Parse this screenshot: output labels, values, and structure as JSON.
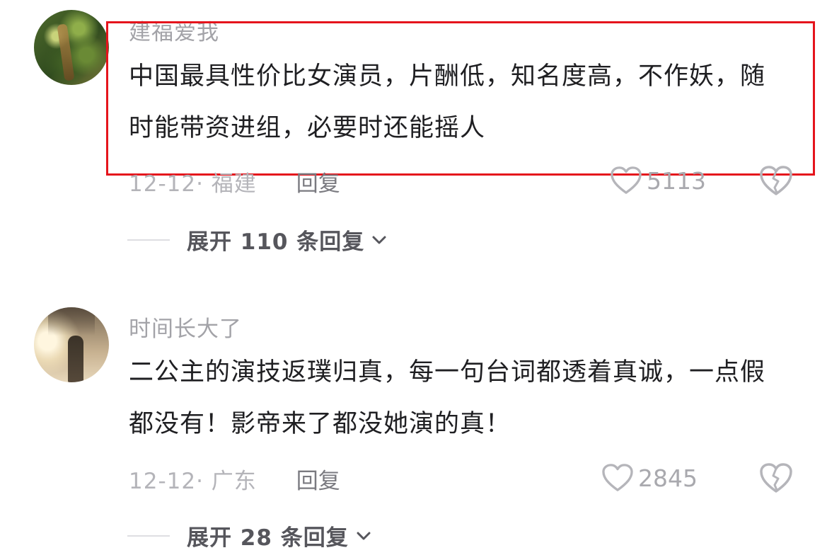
{
  "comments": [
    {
      "username": "建福爱我",
      "text": "中国最具性价比女演员，片酬低，知名度高，不作妖，随时能带资进组，必要时还能摇人",
      "date_location": "12-12· 福建",
      "reply_label": "回复",
      "likes": "5113",
      "expand_label": "展开 110 条回复",
      "highlighted": true,
      "highlight_color": "#e5141c"
    },
    {
      "username": "时间长大了",
      "text": "二公主的演技返璞归真，每一句台词都透着真诚，一点假都没有！影帝来了都没她演的真！",
      "date_location": "12-12· 广东",
      "reply_label": "回复",
      "likes": "2845",
      "expand_label": "展开 28 条回复",
      "highlighted": false
    }
  ],
  "icons": {
    "like": "heart-outline-icon",
    "dislike": "broken-heart-icon",
    "expand": "chevron-down-icon"
  }
}
